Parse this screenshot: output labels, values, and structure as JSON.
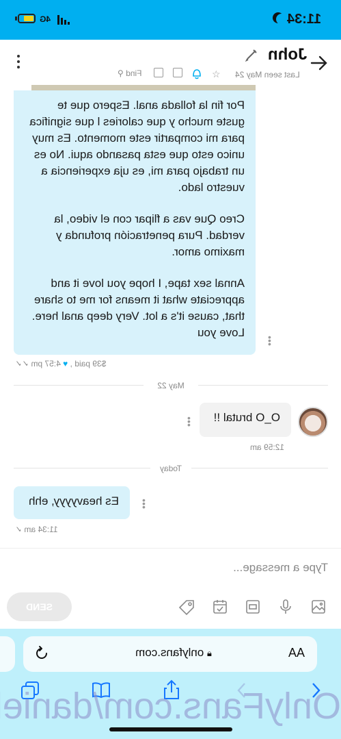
{
  "status_bar": {
    "time": "11:34",
    "network": "4G"
  },
  "header": {
    "contact_name": "John",
    "last_seen": "Last seen May 24",
    "find_label": "Find"
  },
  "messages": {
    "long": {
      "paragraphs": [
        "Por fin la follada anal. Espero que te guste mucho y que calories l que significa para mi compartir este momento. Es muy unico esto que esta pasando aqui. No es un trabajo para mi, es uja experiencia a vuestro lado.",
        "Creo Que vas a flipar con el video, la verdad. Pura penetración profunda y maximo amor.",
        "Annal sex tape, I hope you love it and appreciate what it means for me to share that, cause it's a lot. Very deep anal here. Love you"
      ],
      "price": "$39 paid",
      "time": "4:57 pm"
    },
    "date_sep_1": "May 22",
    "reply": {
      "text": "O_O brutal !!",
      "time": "12:59 am"
    },
    "date_sep_2": "Today",
    "last": {
      "text": "Es heavyyyy, ehh",
      "time": "11:34 am"
    }
  },
  "composer": {
    "placeholder": "Type a message...",
    "send_label": "SEND"
  },
  "browser": {
    "aa_label": "AA",
    "url": "onlyfans.com",
    "watermark": "OnlyFans.com/danielablume"
  }
}
